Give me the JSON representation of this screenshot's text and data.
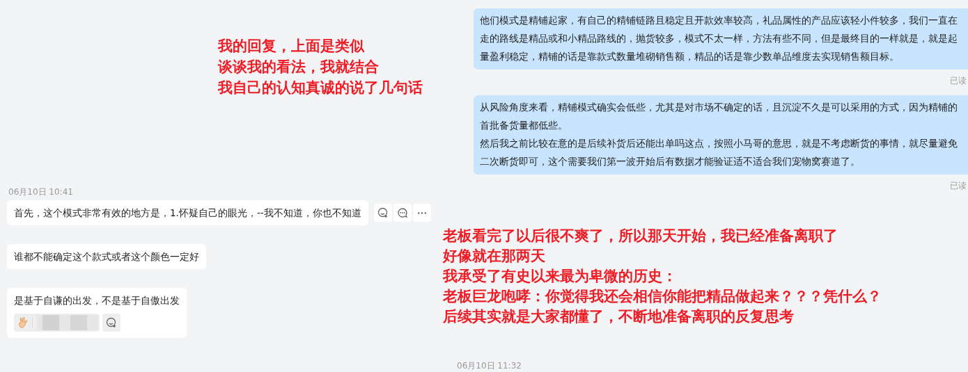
{
  "sent_messages": [
    {
      "paragraphs": [
        "他们模式是精铺起家，有自己的精铺链路且稳定且开款效率较高，礼品属性的产品应该轻小件较多，我们一直在走的路线是精品或和小精品路线的，抛货较多，模式不太一样，方法有些不同，但是最终目的一样就是，就是起量盈利稳定，精铺的话是靠款式数量堆砌销售额，精品的话是靠少数单品维度去实现销售额目标。"
      ],
      "receipt": "已读"
    },
    {
      "paragraphs": [
        "从风险角度来看，精铺模式确实会低些，尤其是对市场不确定的话，且沉淀不久是可以采用的方式，因为精铺的首批备货量都低些。",
        "然后我之前比较在意的是后续补货后还能出单吗这点，按照小马哥的意思，就是不考虑断货的事情，就尽量避免二次断货即可，这个需要我们第一波开始后有数据才能验证适不适合我们宠物窝赛道了。"
      ],
      "receipt": "已读"
    }
  ],
  "timestamp_1": "06月10日 10:41",
  "received_messages": [
    {
      "text": "首先，这个模式非常有效的地方是，1.怀疑自己的眼光，--我不知道，你也不知道",
      "hovered": true,
      "has_reaction": false
    },
    {
      "text": "谁都不能确定这个款式或者这个颜色一定好",
      "hovered": false,
      "has_reaction": false
    },
    {
      "text": "是基于自谦的出发，不是基于自傲出发",
      "hovered": false,
      "has_reaction": true
    }
  ],
  "timestamp_2": "06月10日 11:32",
  "annotations": [
    {
      "lines": [
        "我的回复，上面是类似",
        "谈谈我的看法，我就结合",
        "我自己的认知真诚的说了几句话"
      ]
    },
    {
      "lines": [
        "老板看完了以后很不爽了，所以那天开始，我已经准备离职了",
        "好像就在那两天",
        "我承受了有史以来最为卑微的历史：",
        "老板巨龙咆哮：你觉得我还会相信你能把精品做起来？？？凭什么？",
        "后续其实就是大家都懂了，不断地准备离职的反复思考"
      ]
    }
  ]
}
